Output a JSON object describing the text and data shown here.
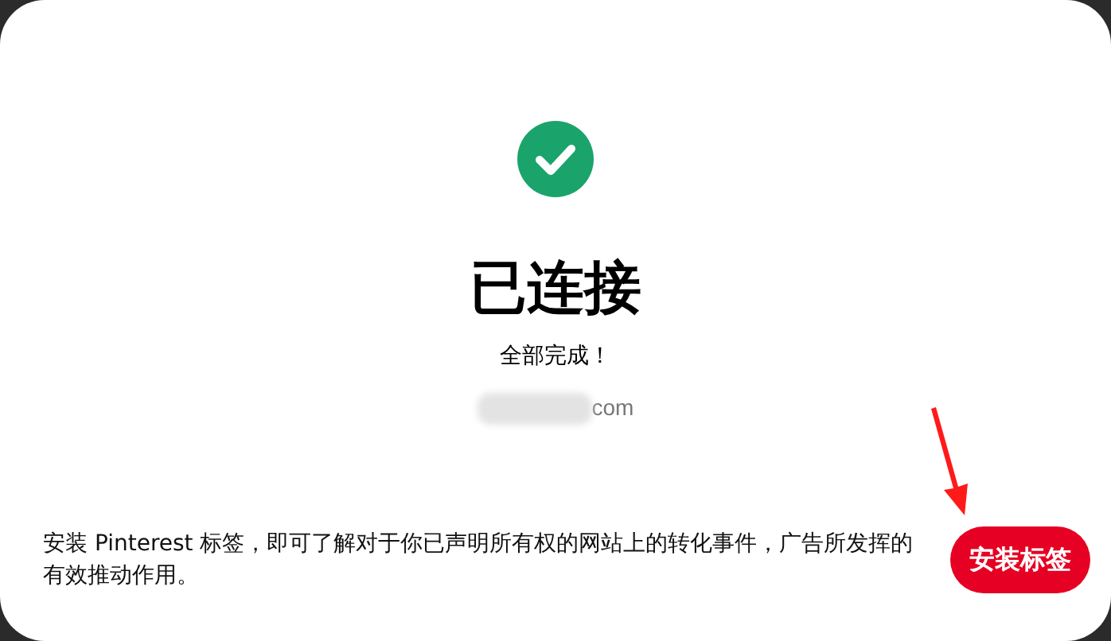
{
  "status": {
    "title": "已连接",
    "subtitle": "全部完成！",
    "account_suffix": "com"
  },
  "footer": {
    "description": "安装 Pinterest 标签，即可了解对于你已声明所有权的网站上的转化事件，广告所发挥的有效推动作用。",
    "button": "安装标签"
  }
}
